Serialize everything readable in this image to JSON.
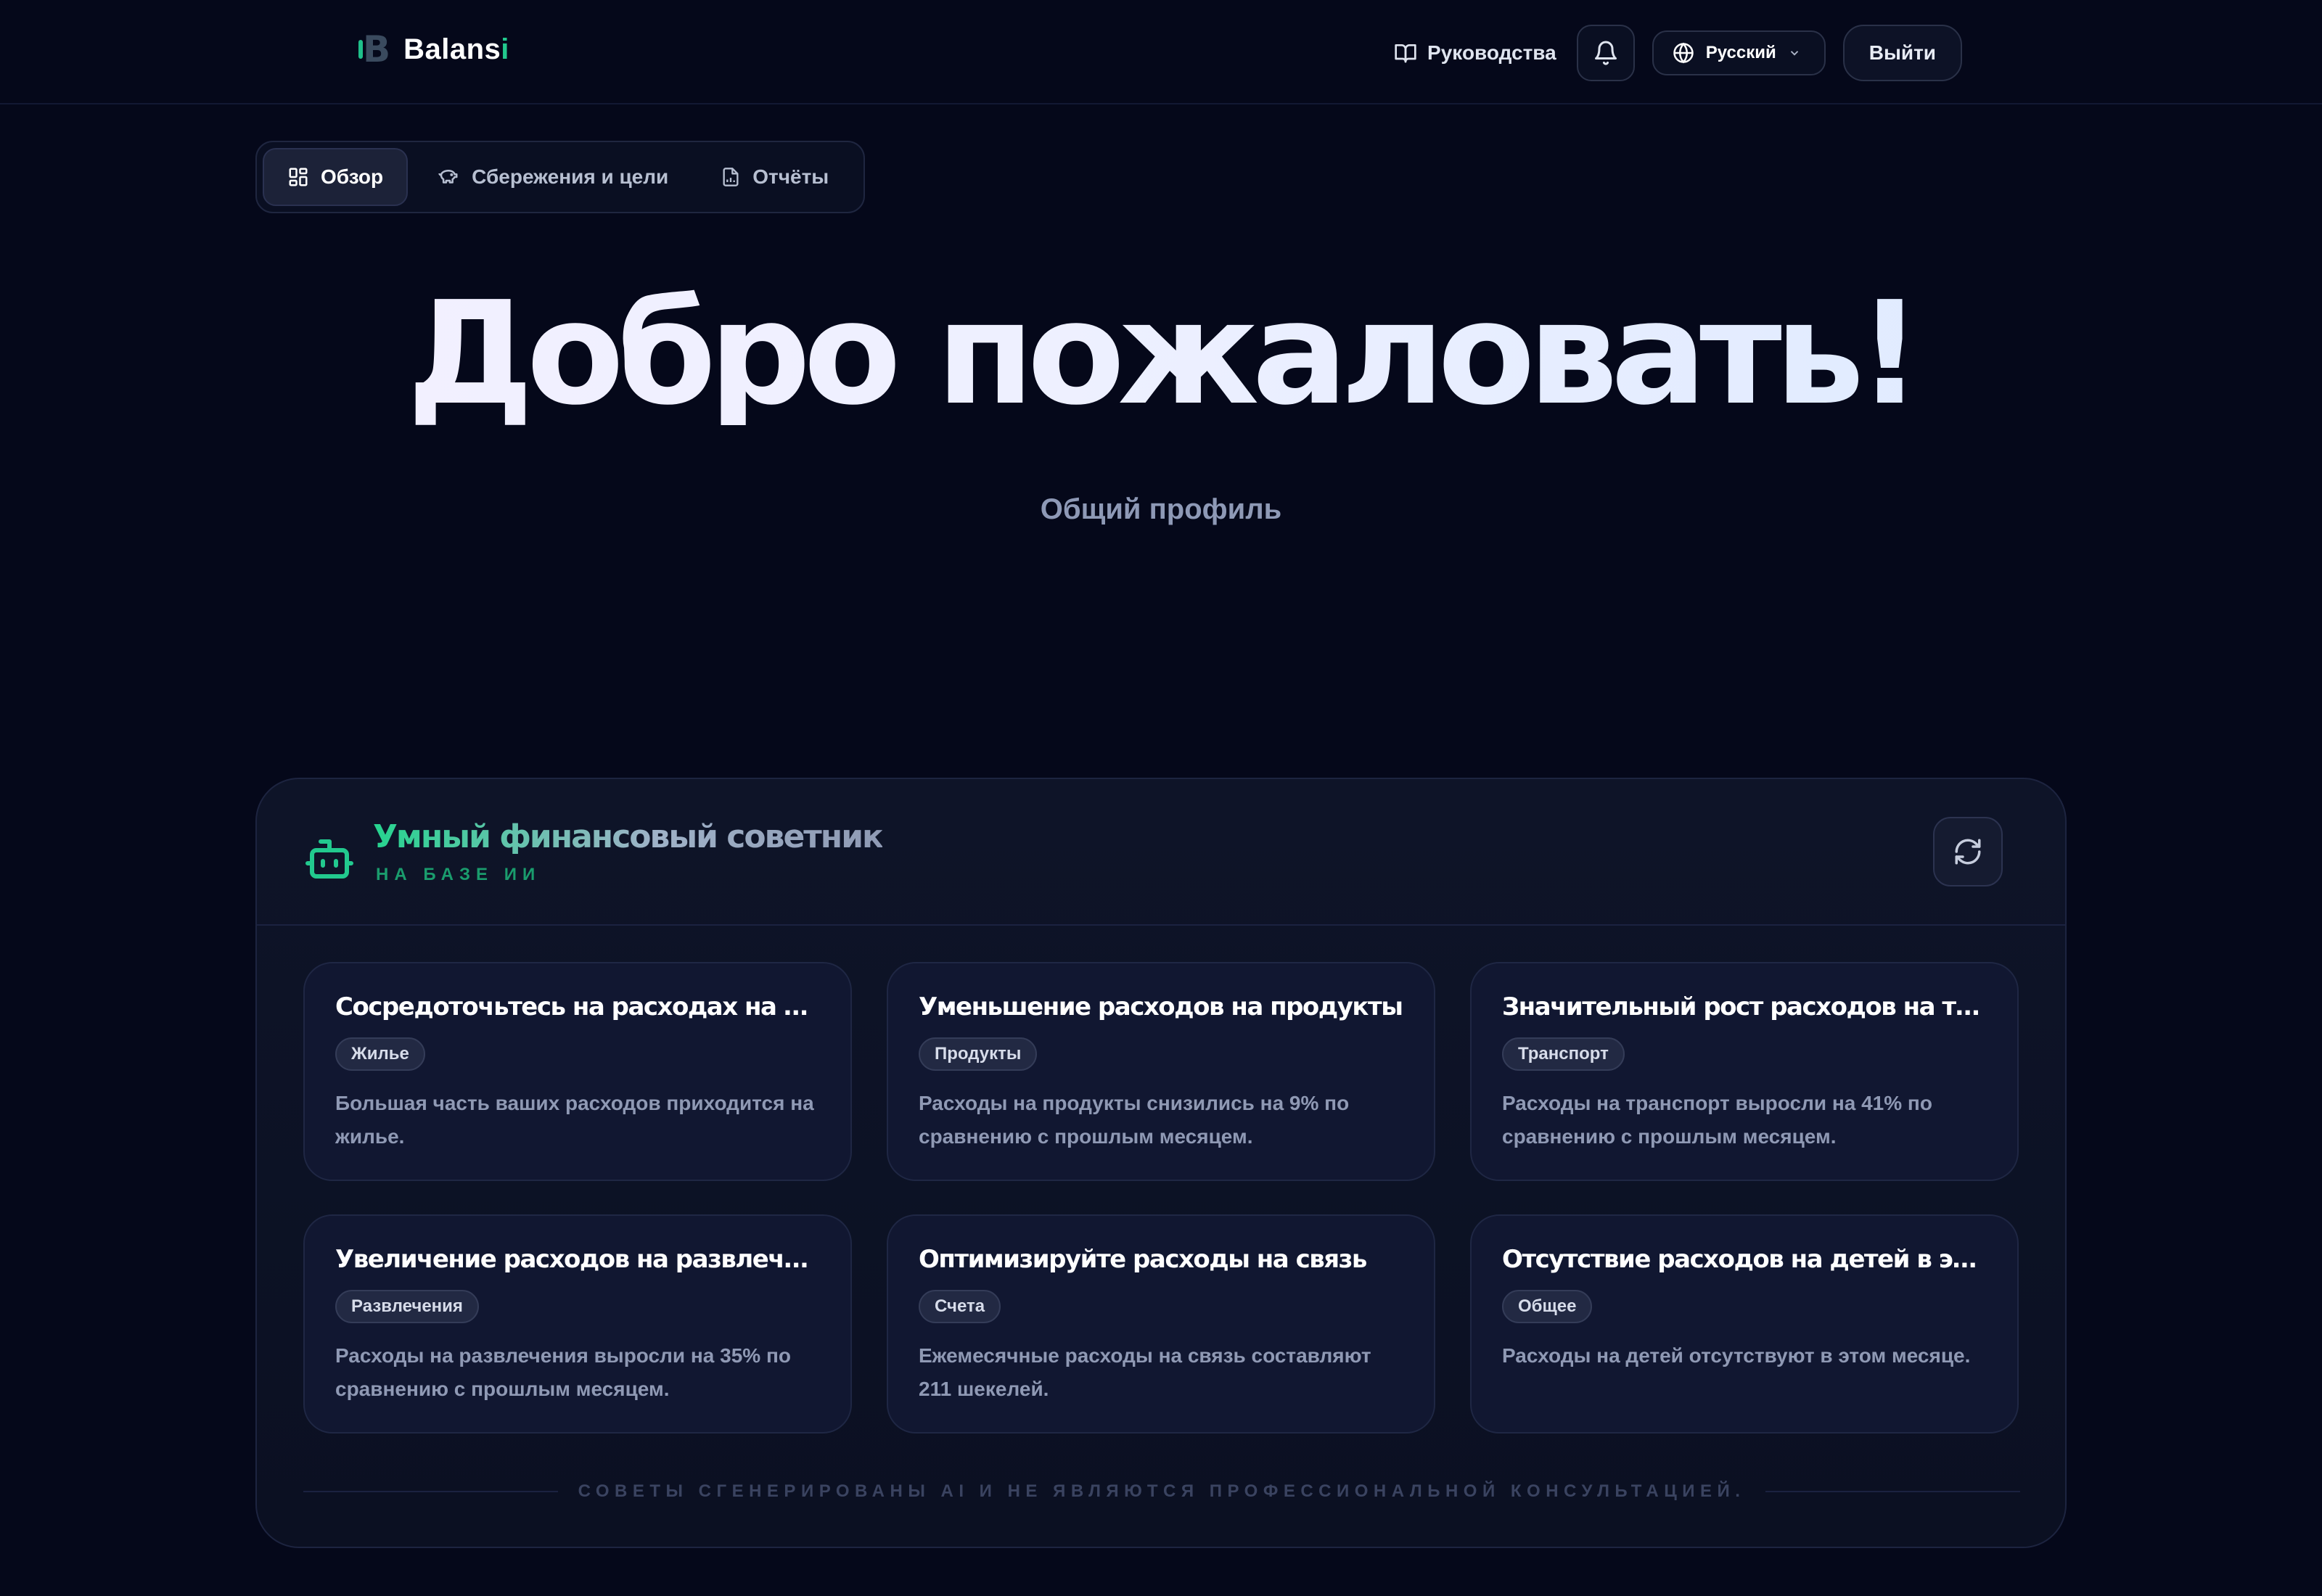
{
  "brand": {
    "name_main": "Balans",
    "name_accent": "i",
    "mark": "B"
  },
  "nav": {
    "guides_label": "Руководства",
    "language_label": "Русский",
    "logout_label": "Выйти"
  },
  "tabs": [
    {
      "label": "Обзор",
      "icon": "grid-icon",
      "active": true
    },
    {
      "label": "Сбережения и цели",
      "icon": "piggy-bank-icon",
      "active": false
    },
    {
      "label": "Отчёты",
      "icon": "report-file-icon",
      "active": false
    }
  ],
  "hero": {
    "title": "Добро пожаловать!",
    "subtitle": "Общий профиль"
  },
  "advisor": {
    "title": "Умный финансовый советник",
    "subtitle": "НА БАЗЕ ИИ",
    "tips": [
      {
        "title": "Сосредоточьтесь на расходах на жилье",
        "category": "Жилье",
        "text": "Большая часть ваших расходов приходится на жилье."
      },
      {
        "title": "Уменьшение расходов на продукты",
        "category": "Продукты",
        "text": "Расходы на продукты снизились на 9% по сравнению с прошлым месяцем."
      },
      {
        "title": "Значительный рост расходов на транспорт",
        "category": "Транспорт",
        "text": "Расходы на транспорт выросли на 41% по сравнению с прошлым месяцем."
      },
      {
        "title": "Увеличение расходов на развлечения",
        "category": "Развлечения",
        "text": "Расходы на развлечения выросли на 35% по сравнению с прошлым месяцем."
      },
      {
        "title": "Оптимизируйте расходы на связь",
        "category": "Счета",
        "text": "Ежемесячные расходы на связь составляют 211 шекелей."
      },
      {
        "title": "Отсутствие расходов на детей в этом месяце",
        "category": "Общее",
        "text": "Расходы на детей отсутствуют в этом месяце."
      }
    ],
    "disclaimer": "СОВЕТЫ СГЕНЕРИРОВАНЫ AI И НЕ ЯВЛЯЮТСЯ ПРОФЕССИОНАЛЬНОЙ КОНСУЛЬТАЦИЕЙ."
  },
  "colors": {
    "background": "#05081a",
    "accent": "#22c98e",
    "card": "#111731"
  }
}
